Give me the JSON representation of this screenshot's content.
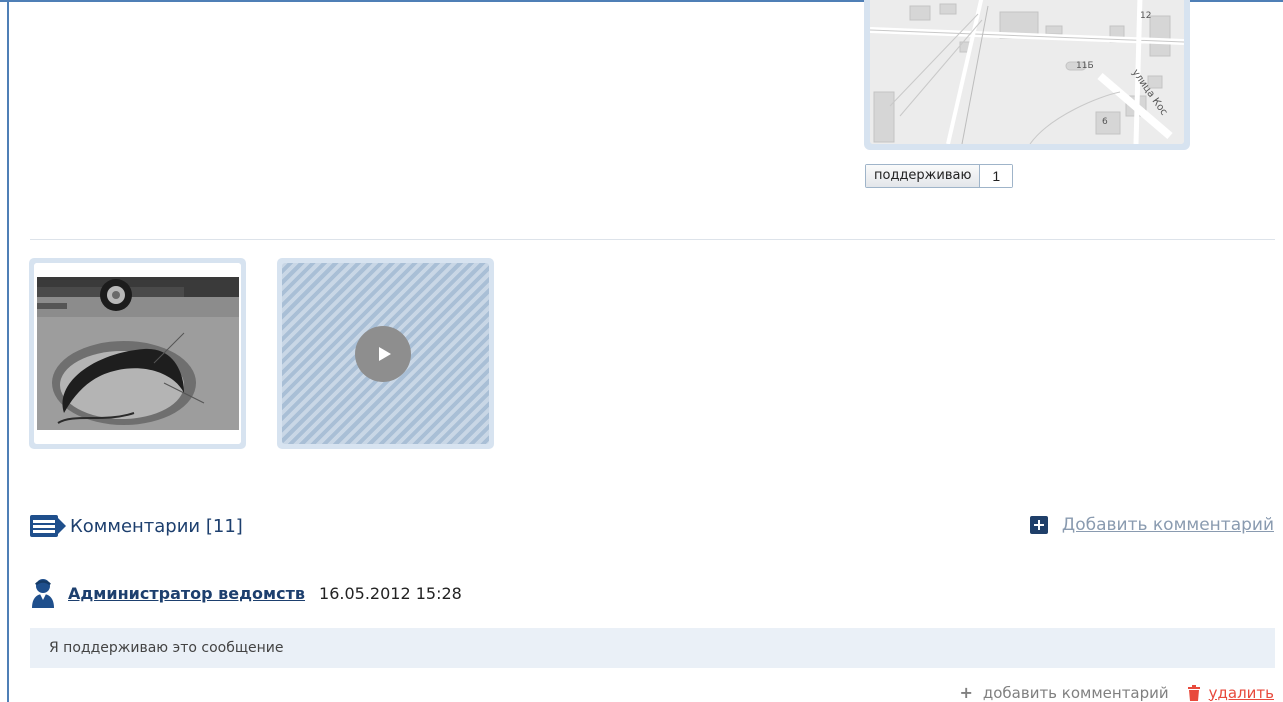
{
  "map": {
    "labels": [
      "12",
      "11Б",
      "6",
      "улица Кос"
    ]
  },
  "support": {
    "label": "поддерживаю",
    "count": "1"
  },
  "media": {
    "photo_icon": "pothole-photo",
    "video_icon": "play-icon"
  },
  "comments": {
    "title": "Комментарии [11]",
    "add_link": "Добавить комментарий",
    "items": [
      {
        "author": "Администратор ведомств",
        "date": "16.05.2012 15:28",
        "text": "Я поддерживаю это сообщение",
        "add_action": "добавить комментарий",
        "delete_action": "удалить"
      }
    ]
  },
  "colors": {
    "frame": "#4f7fb6",
    "accent": "#1d3f6e",
    "delete": "#e84a3c",
    "comment_bg": "#eaf0f7"
  }
}
